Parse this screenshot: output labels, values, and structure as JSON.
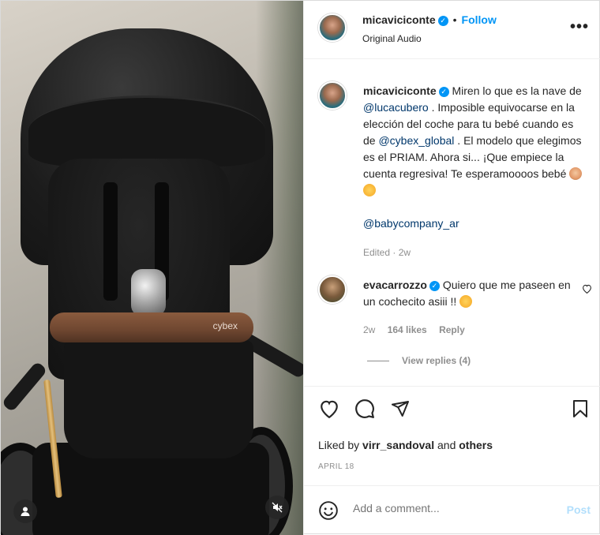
{
  "post": {
    "author": "micaviciconte",
    "follow_label": "Follow",
    "audio": "Original Audio",
    "more_label": "•••"
  },
  "caption": {
    "author": "micaviciconte",
    "parts": [
      "Miren lo que es la nave de ",
      "@lucacubero",
      " . Imposible equivocarse en la elección del coche para tu bebé cuando es de ",
      "@cybex_global",
      " . El modelo que elegimos es el PRIAM. Ahora si... ¡Que empiece la cuenta regresiva! Te esperamoooos bebé "
    ],
    "tag": "@babycompany_ar",
    "edited": "Edited",
    "age": "2w"
  },
  "comment": {
    "author": "evacarrozzo",
    "text": "Quiero que me paseen en un cochecito asiii !! ",
    "age": "2w",
    "likes": "164 likes",
    "reply": "Reply",
    "view_replies": "View replies (4)"
  },
  "likes": {
    "prefix": "Liked by ",
    "user": "virr_sandoval",
    "and": " and ",
    "others": "others"
  },
  "date": "APRIL 18",
  "add_comment": {
    "placeholder": "Add a comment...",
    "post_label": "Post"
  },
  "media": {
    "bumper_brand": "cybex"
  },
  "icons": {
    "user_tag": "user-icon",
    "mute": "speaker-muted-icon",
    "like": "heart-icon",
    "comment": "speech-bubble-icon",
    "share": "paper-plane-icon",
    "save": "bookmark-icon",
    "emoji": "smiley-icon"
  },
  "colors": {
    "link": "#0095f6",
    "mention": "#00376b",
    "muted": "#8e8e8e",
    "post_disabled": "#b2dffc"
  }
}
